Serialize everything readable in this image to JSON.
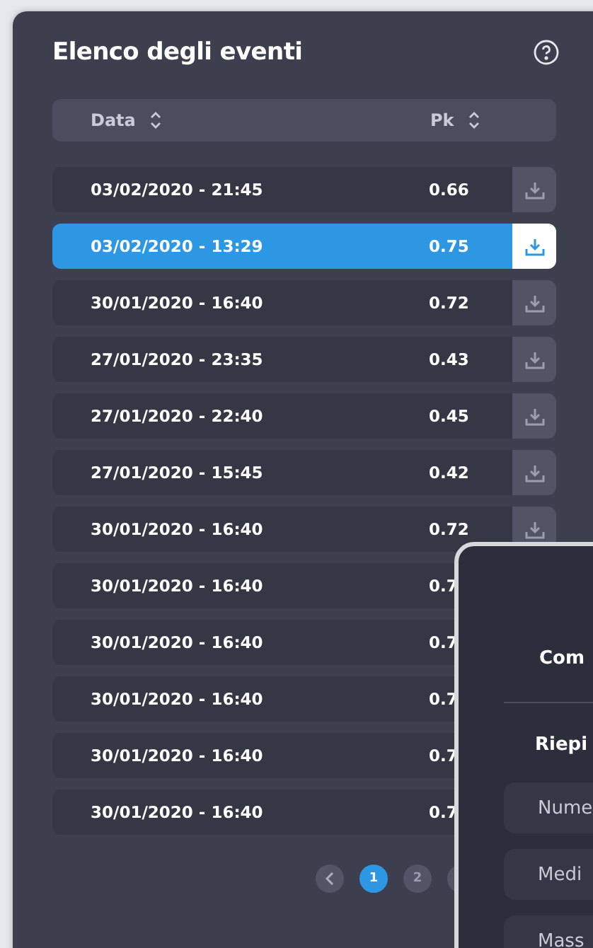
{
  "panel": {
    "title": "Elenco degli eventi",
    "columns": [
      {
        "label": "Data"
      },
      {
        "label": "Pk"
      }
    ],
    "rows": [
      {
        "date": "03/02/2020 - 21:45",
        "pk": "0.66",
        "selected": false,
        "download": true
      },
      {
        "date": "03/02/2020 - 13:29",
        "pk": "0.75",
        "selected": true,
        "download": true
      },
      {
        "date": "30/01/2020 - 16:40",
        "pk": "0.72",
        "selected": false,
        "download": true
      },
      {
        "date": "27/01/2020 - 23:35",
        "pk": "0.43",
        "selected": false,
        "download": true
      },
      {
        "date": "27/01/2020 - 22:40",
        "pk": "0.45",
        "selected": false,
        "download": true
      },
      {
        "date": "27/01/2020 - 15:45",
        "pk": "0.42",
        "selected": false,
        "download": true
      },
      {
        "date": "30/01/2020 - 16:40",
        "pk": "0.72",
        "selected": false,
        "download": true
      },
      {
        "date": "30/01/2020 - 16:40",
        "pk": "0.7",
        "selected": false
      },
      {
        "date": "30/01/2020 - 16:40",
        "pk": "0.7",
        "selected": false
      },
      {
        "date": "30/01/2020 - 16:40",
        "pk": "0.7",
        "selected": false
      },
      {
        "date": "30/01/2020 - 16:40",
        "pk": "0.7",
        "selected": false
      },
      {
        "date": "30/01/2020 - 16:40",
        "pk": "0.7",
        "selected": false
      }
    ],
    "pages": [
      {
        "label": "1",
        "selected": true
      },
      {
        "label": "2",
        "selected": false
      },
      {
        "selected": false
      }
    ]
  },
  "dialog": {
    "heading": "Com",
    "section": "Riepi",
    "fields": [
      {
        "label": "Nume"
      },
      {
        "label": "Medi"
      },
      {
        "label": "Mass"
      }
    ]
  }
}
